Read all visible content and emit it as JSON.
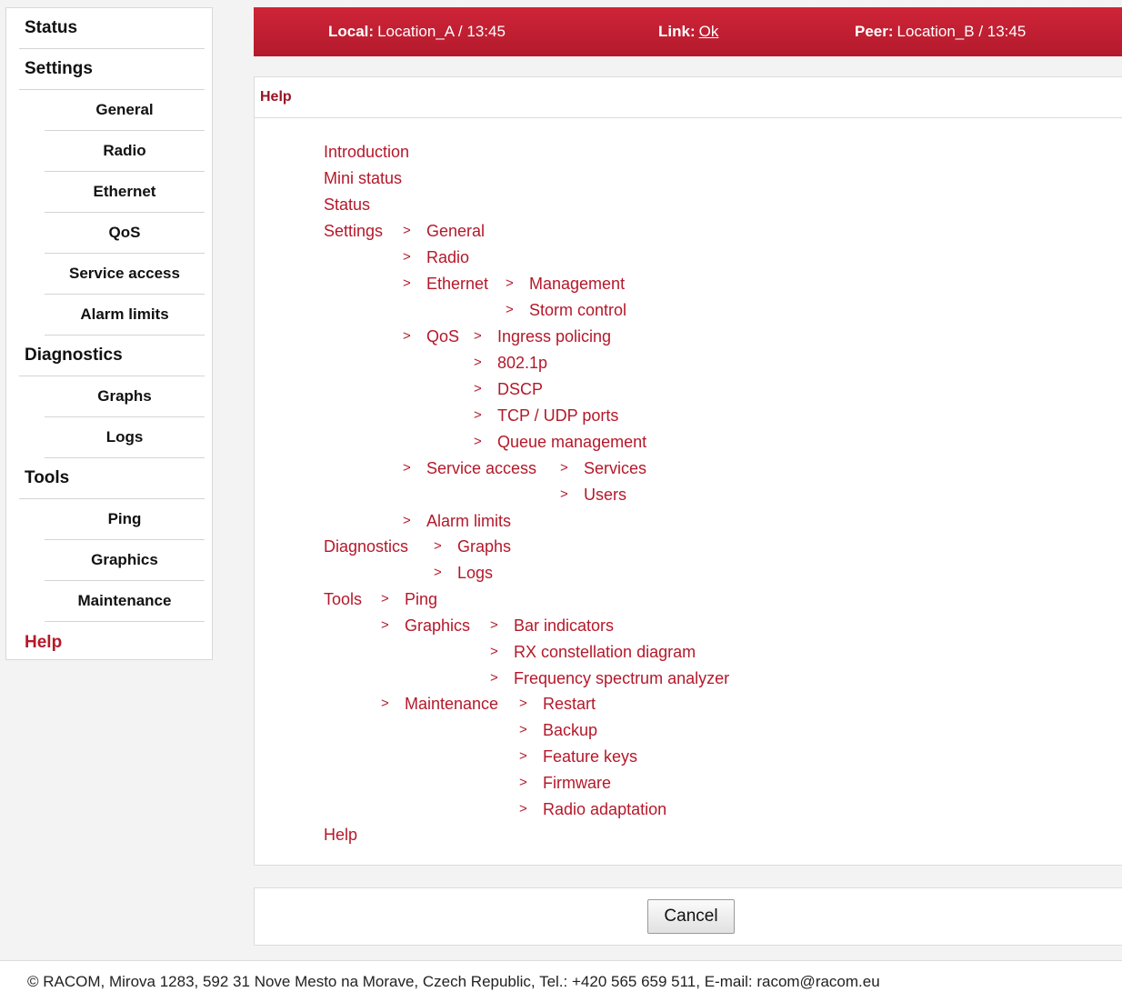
{
  "sidebar": {
    "items": [
      {
        "label": "Status"
      },
      {
        "label": "Settings"
      },
      {
        "label": "General"
      },
      {
        "label": "Radio"
      },
      {
        "label": "Ethernet"
      },
      {
        "label": "QoS"
      },
      {
        "label": "Service access"
      },
      {
        "label": "Alarm limits"
      },
      {
        "label": "Diagnostics"
      },
      {
        "label": "Graphs"
      },
      {
        "label": "Logs"
      },
      {
        "label": "Tools"
      },
      {
        "label": "Ping"
      },
      {
        "label": "Graphics"
      },
      {
        "label": "Maintenance"
      },
      {
        "label": "Help"
      }
    ]
  },
  "header": {
    "local_label": "Local:",
    "local_value": "Location_A / 13:45",
    "link_label": "Link:",
    "link_value": "Ok",
    "peer_label": "Peer:",
    "peer_value": "Location_B / 13:45"
  },
  "help": {
    "title": "Help",
    "arrow": ">",
    "tree": {
      "introduction": "Introduction",
      "mini_status": "Mini status",
      "status": "Status",
      "settings": "Settings",
      "general": "General",
      "radio": "Radio",
      "ethernet": "Ethernet",
      "management": "Management",
      "storm_control": "Storm control",
      "qos": "QoS",
      "ingress_policing": "Ingress policing",
      "p8021": "802.1p",
      "dscp": "DSCP",
      "tcp_udp_ports": "TCP / UDP ports",
      "queue_management": "Queue management",
      "service_access": "Service access",
      "services": "Services",
      "users": "Users",
      "alarm_limits": "Alarm limits",
      "diagnostics": "Diagnostics",
      "graphs": "Graphs",
      "logs": "Logs",
      "tools": "Tools",
      "ping": "Ping",
      "graphics": "Graphics",
      "bar_indicators": "Bar indicators",
      "rx_constellation": "RX constellation diagram",
      "spectrum_analyzer": "Frequency spectrum analyzer",
      "maintenance": "Maintenance",
      "restart": "Restart",
      "backup": "Backup",
      "feature_keys": "Feature keys",
      "firmware": "Firmware",
      "radio_adaptation": "Radio adaptation",
      "help": "Help"
    }
  },
  "buttons": {
    "cancel": "Cancel"
  },
  "footer": {
    "text": "© RACOM, Mirova 1283, 592 31 Nove Mesto na Morave, Czech Republic, Tel.: +420 565 659 511, E-mail: racom@racom.eu"
  },
  "colors": {
    "accent": "#b5182a",
    "header_bg": "#c4202f"
  }
}
